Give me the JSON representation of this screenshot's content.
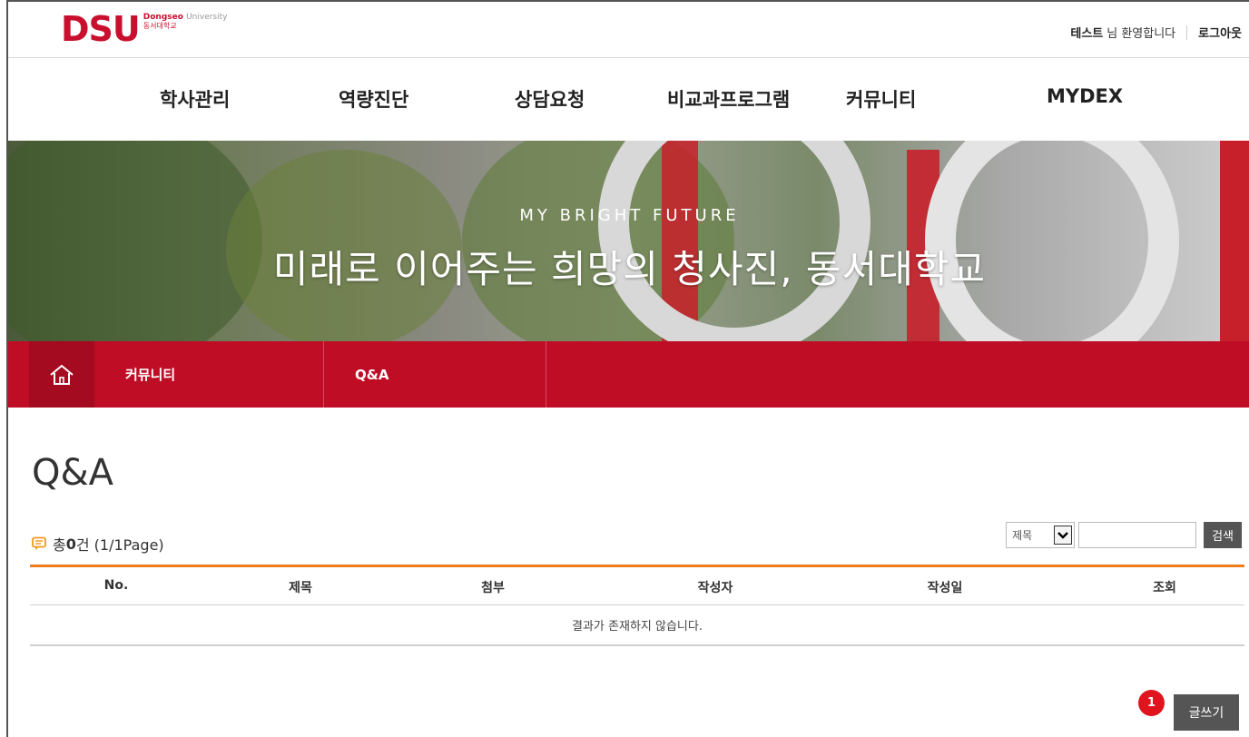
{
  "header": {
    "logo_text": "DSU",
    "logo_en_bold": "Dongseo",
    "logo_en_light": "University",
    "logo_ko": "동서대학교",
    "user_name": "테스트",
    "welcome": "님 환영합니다",
    "logout": "로그아웃"
  },
  "nav": {
    "items": [
      {
        "label": "학사관리"
      },
      {
        "label": "역량진단"
      },
      {
        "label": "상담요청"
      },
      {
        "label": "비교과프로그램"
      },
      {
        "label": "커뮤니티"
      },
      {
        "label": "MYDEX"
      }
    ]
  },
  "hero": {
    "slogan_en": "MY BRIGHT FUTURE",
    "slogan_ko": "미래로 이어주는 희망의 청사진, 동서대학교"
  },
  "breadcrumb": {
    "home_icon": "home-icon",
    "items": [
      {
        "label": "커뮤니티"
      },
      {
        "label": "Q&A"
      }
    ],
    "color": "#c00d26"
  },
  "main": {
    "title": "Q&A",
    "count_icon": "speech-bubble-icon",
    "count_prefix": "총",
    "count_value": "0",
    "count_suffix": "건 (1/1Page)",
    "search": {
      "select_value": "제목",
      "input_value": "",
      "button_label": "검색"
    },
    "table": {
      "columns": [
        "No.",
        "제목",
        "첨부",
        "작성자",
        "작성일",
        "조회"
      ],
      "empty_message": "결과가 존재하지 않습니다."
    },
    "annotation_badge": "1",
    "write_button": "글쓰기"
  },
  "colors": {
    "brand_red": "#c8102e",
    "table_accent": "#ef7d1c",
    "button_gray": "#555555"
  }
}
